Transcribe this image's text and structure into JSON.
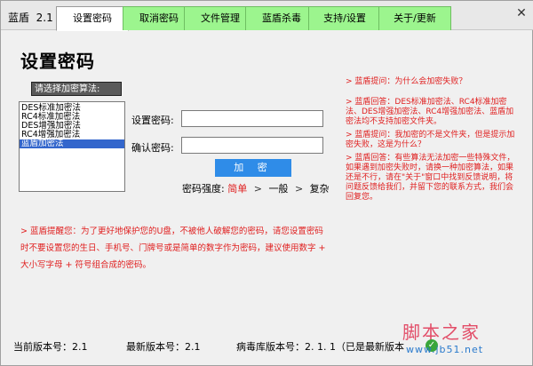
{
  "app": {
    "title": "蓝盾",
    "version": "2.1"
  },
  "tabs": [
    {
      "label": "设置密码",
      "active": true
    },
    {
      "label": "取消密码"
    },
    {
      "label": "文件管理"
    },
    {
      "label": "蓝盾杀毒"
    },
    {
      "label": "支持/设置"
    },
    {
      "label": "关于/更新"
    }
  ],
  "close_label": "✕",
  "page": {
    "title": "设置密码"
  },
  "algorithms": {
    "header": "请选择加密算法:",
    "items": [
      "DES标准加密法",
      "RC4标准加密法",
      "DES增强加密法",
      "RC4增强加密法",
      "蓝盾加密法"
    ],
    "selected_index": 4
  },
  "form": {
    "password_label": "设置密码:",
    "password_value": "",
    "confirm_label": "确认密码:",
    "confirm_value": "",
    "encrypt_label": "加 密"
  },
  "strength": {
    "label": "密码强度:",
    "weak": "简单",
    "medium": "一般",
    "strong": "复杂",
    "arrow": ">"
  },
  "faq": [
    "> 蓝盾提问：为什么会加密失败？",
    "> 蓝盾回答：DES标准加密法、RC4标准加密法、DES增强加密法、RC4增强加密法、蓝盾加密法均不支持加密文件夹。",
    "> 蓝盾提问：我加密的不是文件夹，但是提示加密失败，这是为什么？",
    "> 蓝盾回答：有些算法无法加密一些特殊文件，如果遇到加密失败时，请换一种加密算法，如果还是不行，请在\"关于\"窗口中找到反馈说明，将问题反馈给我们，并留下您的联系方式，我们会回复您。"
  ],
  "tip": "> 蓝盾提醒您：为了更好地保护您的U盘，不被他人破解您的密码，请您设置密码时不要设置您的生日、手机号、门牌号或是简单的数字作为密码，建议使用数字 + 大小写字母 + 符号组合成的密码。",
  "status": {
    "current_version_label": "当前版本号：",
    "current_version": "2.1",
    "latest_version_label": "最新版本号：",
    "latest_version": "2.1",
    "virus_db_label": "病毒库版本号：",
    "virus_db_version": "2. 1. 1",
    "virus_db_note": "（已是最新版本"
  },
  "watermark": {
    "text": "脚本之家",
    "sub": "www.jb51.net"
  }
}
